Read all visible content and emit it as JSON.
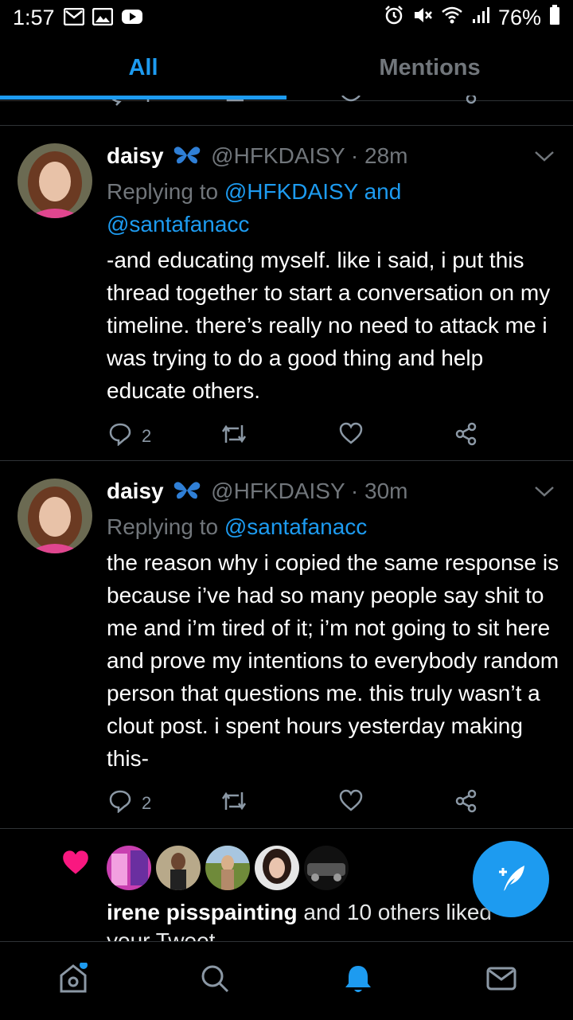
{
  "status_bar": {
    "time": "1:57",
    "battery": "76%",
    "left_icons": [
      "gmail-icon",
      "gallery-icon",
      "youtube-icon"
    ],
    "right_icons": [
      "alarm-icon",
      "mute-icon",
      "wifi-icon",
      "signal-icon",
      "battery-icon"
    ]
  },
  "tabs": [
    {
      "label": "All",
      "active": true
    },
    {
      "label": "Mentions",
      "active": false
    }
  ],
  "tweets": [
    {
      "name": "daisy",
      "handle": "@HFKDAISY",
      "time": "· 28m",
      "replying_prefix": "Replying to ",
      "replying_to_1": "@HFKDAISY and",
      "replying_to_2": "@santafanacc",
      "text": "-and educating myself. like i said, i put this thread together to start a conversation on my timeline. there’s really no need to attack me i was trying to do a good thing and help educate others.",
      "reply_count": "2"
    },
    {
      "name": "daisy",
      "handle": "@HFKDAISY",
      "time": "· 30m",
      "replying_prefix": "Replying to ",
      "replying_to_1": "@santafanacc",
      "text": "the reason why i copied the same response is because i’ve had so many people say shit to me and i’m tired of it; i’m not going to sit here and prove my intentions to everybody random person that questions me. this truly wasn’t a clout post. i spent hours yesterday making this-",
      "reply_count": "2"
    }
  ],
  "notification": {
    "liker_name": "irene pisspainting",
    "liked_suffix": " and 10 others liked",
    "liked_line2": "your Tweet"
  },
  "colors": {
    "accent": "#1d9bf0",
    "like_red": "#f91880",
    "background": "#000000",
    "muted": "#71767b"
  },
  "bottom_nav": [
    "home-icon",
    "search-icon",
    "notifications-icon",
    "messages-icon"
  ]
}
